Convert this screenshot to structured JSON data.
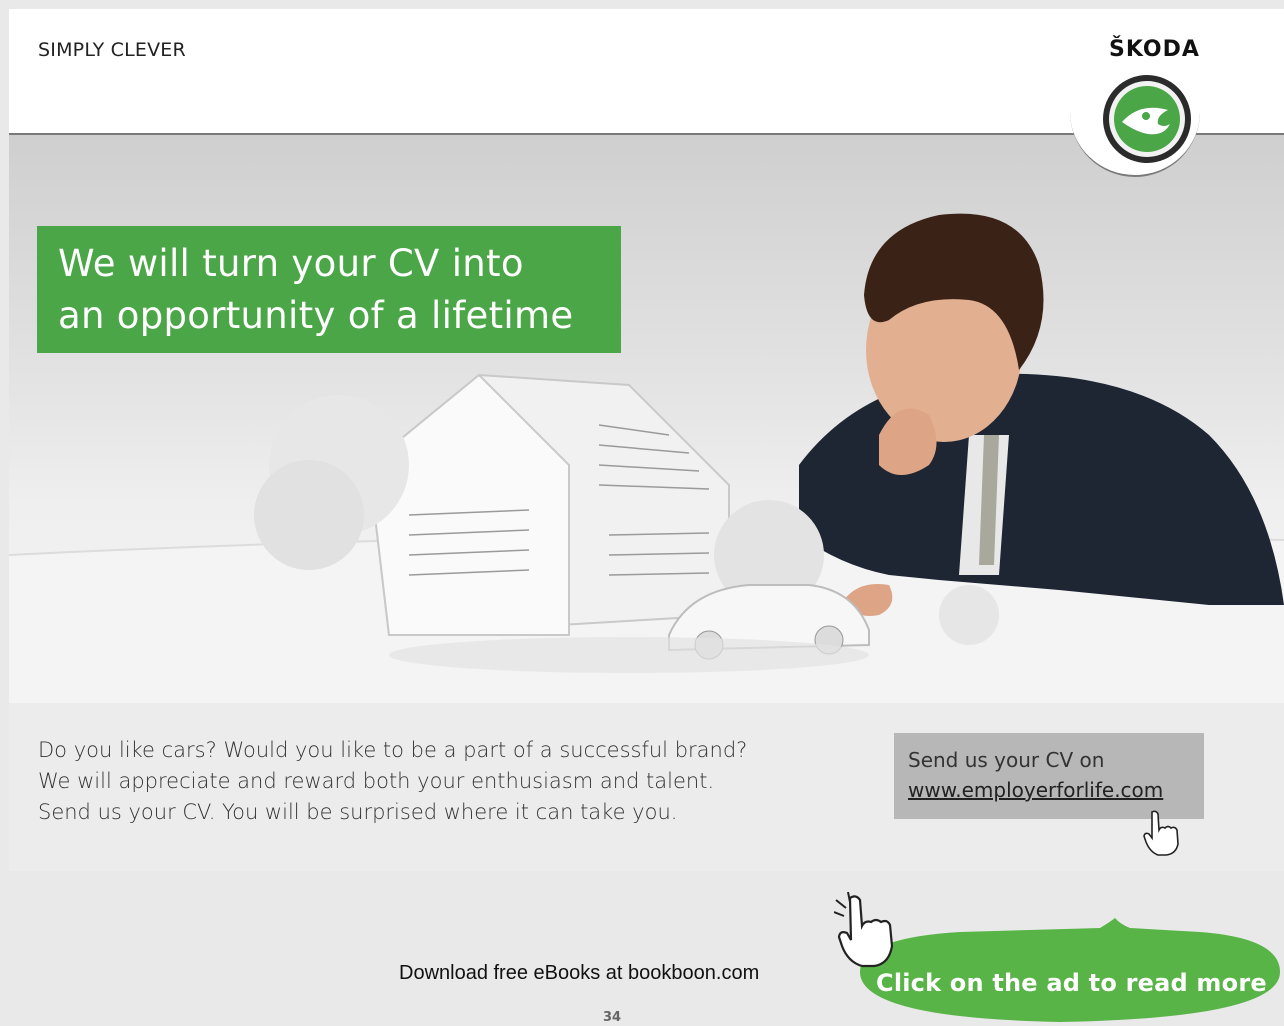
{
  "ad": {
    "tagline": "SIMPLY CLEVER",
    "brand": "ŠKODA",
    "headline_line1": "We will turn your CV into",
    "headline_line2": "an opportunity of a lifetime",
    "body": [
      "Do you like cars? Would you like to be a part of a successful brand?",
      "We will appreciate and reward both your enthusiasm and talent.",
      "Send us your CV. You will be surprised where it can take you."
    ],
    "cv_box": {
      "label": "Send us your CV on",
      "link": "www.employerforlife.com"
    },
    "colors": {
      "accent_green": "#4ba648",
      "cta_green": "#58b447",
      "cv_box_grey": "#b7b7b7"
    }
  },
  "footer": {
    "download_text": "Download free eBooks at bookboon.com",
    "cta_label": "Click on the ad to read more",
    "page_number": "34"
  },
  "icons": [
    "skoda-logo-icon",
    "hand-cursor-icon"
  ]
}
